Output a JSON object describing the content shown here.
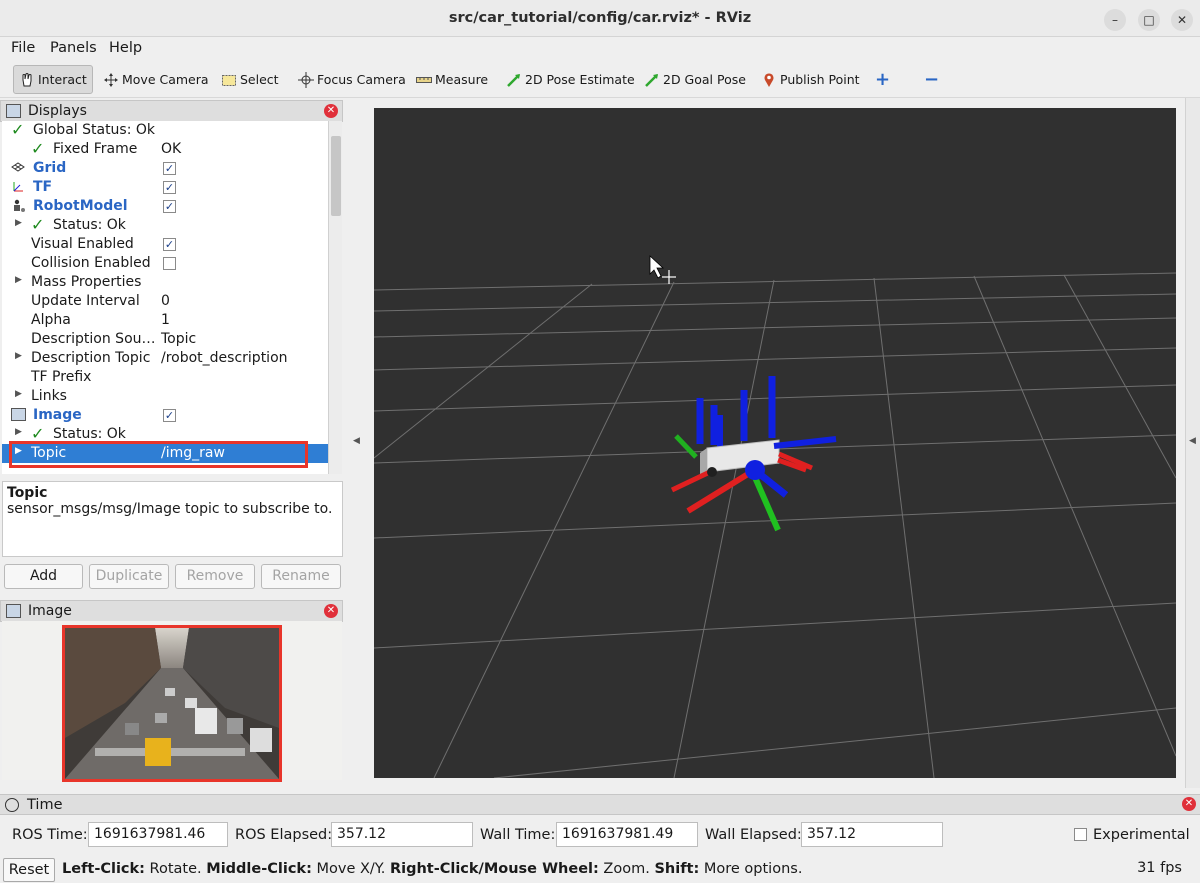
{
  "window": {
    "title": "src/car_tutorial/config/car.rviz* - RViz",
    "controls": {
      "minimize": "–",
      "maximize": "□",
      "close": "✕"
    }
  },
  "menu": [
    "File",
    "Panels",
    "Help"
  ],
  "toolbar": {
    "tools": [
      "Interact",
      "Move Camera",
      "Select",
      "Focus Camera",
      "Measure",
      "2D Pose Estimate",
      "2D Goal Pose",
      "Publish Point"
    ],
    "add": "+",
    "remove": "−"
  },
  "displays": {
    "title": "Displays",
    "rows": {
      "global_status": {
        "label": "Global Status: Ok"
      },
      "fixed_frame": {
        "label": "Fixed Frame",
        "value": "OK"
      },
      "grid": {
        "label": "Grid",
        "checked": "✓"
      },
      "tf": {
        "label": "TF",
        "checked": "✓"
      },
      "robot_model": {
        "label": "RobotModel",
        "checked": "✓"
      },
      "rm_status": {
        "label": "Status: Ok"
      },
      "visual_enabled": {
        "label": "Visual Enabled",
        "checked": "✓"
      },
      "collision_enabled": {
        "label": "Collision Enabled",
        "checked": ""
      },
      "mass_properties": {
        "label": "Mass Properties"
      },
      "update_interval": {
        "label": "Update Interval",
        "value": "0"
      },
      "alpha": {
        "label": "Alpha",
        "value": "1"
      },
      "description_source": {
        "label": "Description Sou…",
        "value": "Topic"
      },
      "description_topic": {
        "label": "Description Topic",
        "value": "/robot_description"
      },
      "tf_prefix": {
        "label": "TF Prefix"
      },
      "links": {
        "label": "Links"
      },
      "image": {
        "label": "Image",
        "checked": "✓"
      },
      "img_status": {
        "label": "Status: Ok"
      },
      "topic": {
        "label": "Topic",
        "value": "/img_raw"
      }
    }
  },
  "description": {
    "title": "Topic",
    "text": "sensor_msgs/msg/Image topic to subscribe to."
  },
  "buttons": {
    "add": "Add",
    "duplicate": "Duplicate",
    "remove": "Remove",
    "rename": "Rename"
  },
  "image_panel": {
    "title": "Image"
  },
  "time_panel": {
    "title": "Time",
    "ros_time_label": "ROS Time:",
    "ros_time": "1691637981.46",
    "ros_elapsed_label": "ROS Elapsed:",
    "ros_elapsed": "357.12",
    "wall_time_label": "Wall Time:",
    "wall_time": "1691637981.49",
    "wall_elapsed_label": "Wall Elapsed:",
    "wall_elapsed": "357.12",
    "experimental": "Experimental"
  },
  "status": {
    "reset": "Reset",
    "hint_parts": [
      {
        "bold": "Left-Click:",
        "text": " Rotate. "
      },
      {
        "bold": "Middle-Click:",
        "text": " Move X/Y. "
      },
      {
        "bold": "Right-Click/Mouse Wheel:",
        "text": " Zoom. "
      },
      {
        "bold": "Shift:",
        "text": " More options."
      }
    ],
    "fps": "31 fps"
  },
  "colors": {
    "selection": "#2f7ed4",
    "highlight_box": "#e8352a",
    "viewport": "#303030",
    "axis_x": "#e02020",
    "axis_y": "#20c020",
    "axis_z": "#1020e0"
  }
}
